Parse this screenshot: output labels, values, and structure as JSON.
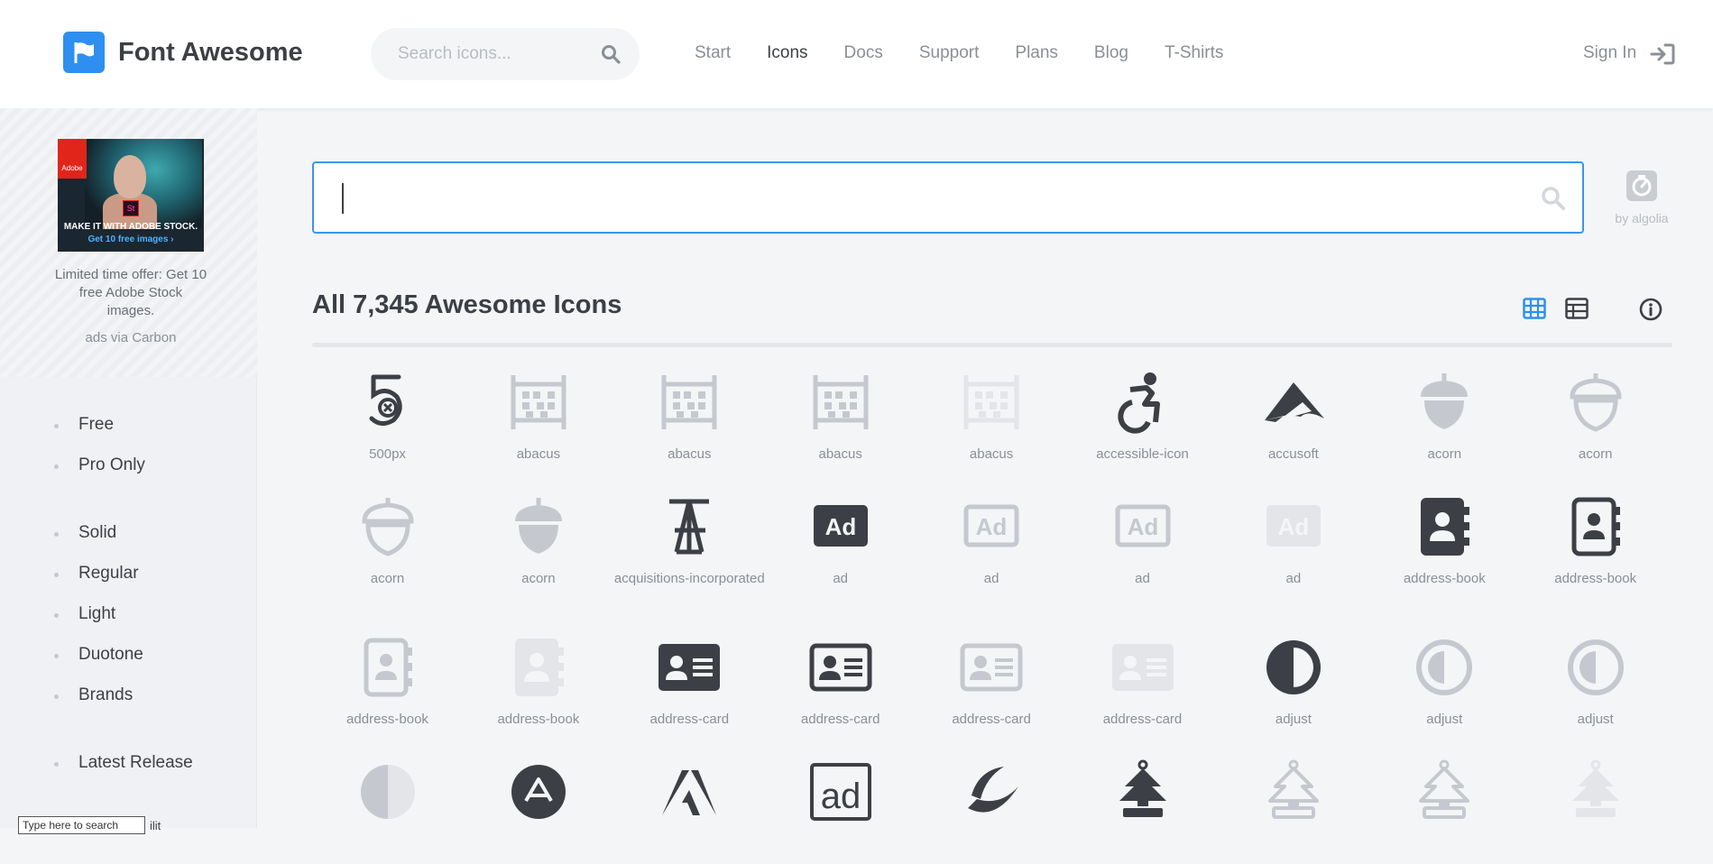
{
  "header": {
    "logo_text": "Font Awesome",
    "search_placeholder": "Search icons...",
    "nav": [
      "Start",
      "Icons",
      "Docs",
      "Support",
      "Plans",
      "Blog",
      "T-Shirts"
    ],
    "active_nav": "Icons",
    "sign_in": "Sign In"
  },
  "ad": {
    "badge": "Adobe",
    "product": "St",
    "caption1": "MAKE IT WITH ADOBE STOCK.",
    "caption2": "Get 10 free images ›",
    "text": "Limited time offer: Get 10 free Adobe Stock images.",
    "via": "ads via Carbon"
  },
  "filters": {
    "group1": [
      "Free",
      "Pro Only"
    ],
    "group2": [
      "Solid",
      "Regular",
      "Light",
      "Duotone",
      "Brands"
    ],
    "group3": [
      "Latest Release"
    ]
  },
  "tooltip": {
    "text": "Type here to search",
    "tail": "ilit"
  },
  "main": {
    "algolia": "by algolia",
    "heading": "All 7,345 Awesome Icons"
  },
  "colors": {
    "accent": "#2e8ff0",
    "dark": "#3c3f45",
    "muted": "#8a8f97",
    "faint": "#c9ccd1"
  },
  "icons": [
    {
      "name": "500px",
      "tone": "dark",
      "shape": "500px-icon"
    },
    {
      "name": "abacus",
      "tone": "light",
      "shape": "abacus-icon"
    },
    {
      "name": "abacus",
      "tone": "light",
      "shape": "abacus-icon"
    },
    {
      "name": "abacus",
      "tone": "light",
      "shape": "abacus-icon"
    },
    {
      "name": "abacus",
      "tone": "faint",
      "shape": "abacus-icon"
    },
    {
      "name": "accessible-icon",
      "tone": "dark",
      "shape": "accessible-icon"
    },
    {
      "name": "accusoft",
      "tone": "dark",
      "shape": "accusoft-icon"
    },
    {
      "name": "acorn",
      "tone": "light",
      "shape": "acorn-icon"
    },
    {
      "name": "acorn",
      "tone": "light",
      "shape": "acorn-outline-icon"
    },
    {
      "name": "acorn",
      "tone": "light",
      "shape": "acorn-outline-icon"
    },
    {
      "name": "acorn",
      "tone": "light",
      "shape": "acorn-icon"
    },
    {
      "name": "acquisitions-incorporated",
      "tone": "dark",
      "shape": "acquisitions-icon"
    },
    {
      "name": "ad",
      "tone": "dark",
      "shape": "ad-solid-icon"
    },
    {
      "name": "ad",
      "tone": "light",
      "shape": "ad-outline-icon"
    },
    {
      "name": "ad",
      "tone": "light",
      "shape": "ad-outline-icon"
    },
    {
      "name": "ad",
      "tone": "faint",
      "shape": "ad-solid-icon"
    },
    {
      "name": "address-book",
      "tone": "dark",
      "shape": "address-book-solid-icon"
    },
    {
      "name": "address-book",
      "tone": "dark",
      "shape": "address-book-outline-icon"
    },
    {
      "name": "address-book",
      "tone": "light",
      "shape": "address-book-outline-icon"
    },
    {
      "name": "address-book",
      "tone": "faint",
      "shape": "address-book-solid-icon"
    },
    {
      "name": "address-card",
      "tone": "dark",
      "shape": "address-card-solid-icon"
    },
    {
      "name": "address-card",
      "tone": "dark",
      "shape": "address-card-outline-icon"
    },
    {
      "name": "address-card",
      "tone": "light",
      "shape": "address-card-outline-icon"
    },
    {
      "name": "address-card",
      "tone": "faint",
      "shape": "address-card-solid-icon"
    },
    {
      "name": "adjust",
      "tone": "dark",
      "shape": "adjust-icon"
    },
    {
      "name": "adjust",
      "tone": "light",
      "shape": "adjust-outline-icon"
    },
    {
      "name": "adjust",
      "tone": "light",
      "shape": "adjust-outline-icon"
    },
    {
      "name": "",
      "tone": "faint",
      "shape": "adjust-duotone-icon"
    },
    {
      "name": "",
      "tone": "dark",
      "shape": "adn-icon"
    },
    {
      "name": "",
      "tone": "dark",
      "shape": "adobe-icon"
    },
    {
      "name": "",
      "tone": "dark",
      "shape": "adversal-icon"
    },
    {
      "name": "",
      "tone": "dark",
      "shape": "affiliatetheme-icon"
    },
    {
      "name": "",
      "tone": "dark",
      "shape": "air-freshener-icon"
    },
    {
      "name": "",
      "tone": "light",
      "shape": "air-freshener-outline-icon"
    },
    {
      "name": "",
      "tone": "light",
      "shape": "air-freshener-outline-icon"
    },
    {
      "name": "",
      "tone": "faint",
      "shape": "air-freshener-icon"
    }
  ]
}
